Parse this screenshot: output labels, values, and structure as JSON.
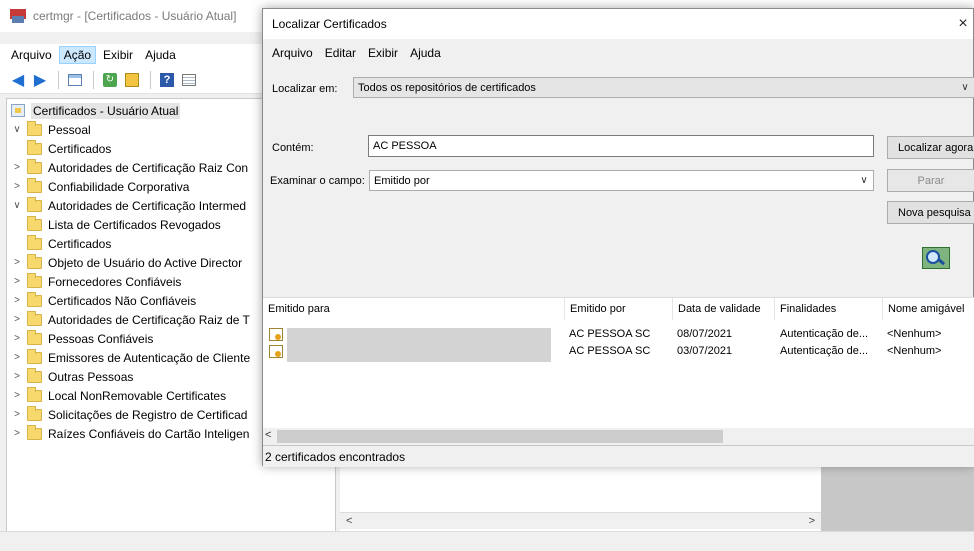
{
  "main_window": {
    "title": "certmgr - [Certificados - Usuário Atual]",
    "menu": [
      "Arquivo",
      "Ação",
      "Exibir",
      "Ajuda"
    ],
    "active_menu": "Ação",
    "toolbar_icons": [
      "back-arrow-icon",
      "forward-arrow-icon",
      "show-hide-tree-icon",
      "refresh-icon",
      "export-list-icon",
      "help-icon",
      "properties-view-icon"
    ],
    "tree": {
      "root": "Certificados - Usuário Atual",
      "items": [
        {
          "label": "Pessoal",
          "level": 1,
          "expanded": true
        },
        {
          "label": "Certificados",
          "level": 2
        },
        {
          "label": "Autoridades de Certificação Raiz Con",
          "level": 1,
          "expanded": false
        },
        {
          "label": "Confiabilidade Corporativa",
          "level": 1,
          "expanded": false
        },
        {
          "label": "Autoridades de Certificação Intermed",
          "level": 1,
          "expanded": true
        },
        {
          "label": "Lista de Certificados Revogados",
          "level": 2
        },
        {
          "label": "Certificados",
          "level": 2
        },
        {
          "label": "Objeto de Usuário do Active Director",
          "level": 1,
          "expanded": false
        },
        {
          "label": "Fornecedores Confiáveis",
          "level": 1,
          "expanded": false
        },
        {
          "label": "Certificados Não Confiáveis",
          "level": 1,
          "expanded": false
        },
        {
          "label": "Autoridades de Certificação Raiz de T",
          "level": 1,
          "expanded": false
        },
        {
          "label": "Pessoas Confiáveis",
          "level": 1,
          "expanded": false
        },
        {
          "label": "Emissores de Autenticação de Cliente",
          "level": 1,
          "expanded": false
        },
        {
          "label": "Outras Pessoas",
          "level": 1,
          "expanded": false
        },
        {
          "label": "Local NonRemovable Certificates",
          "level": 1,
          "expanded": false
        },
        {
          "label": "Solicitações de Registro de Certificad",
          "level": 1,
          "expanded": false
        },
        {
          "label": "Raízes Confiáveis do Cartão Inteligen",
          "level": 1,
          "expanded": false
        }
      ]
    }
  },
  "dialog": {
    "title": "Localizar Certificados",
    "close_glyph": "×",
    "menu": [
      "Arquivo",
      "Editar",
      "Exibir",
      "Ajuda"
    ],
    "localizar_em_label": "Localizar em:",
    "localizar_em_value": "Todos os repositórios de certificados",
    "contem_label": "Contém:",
    "contem_value": "AC PESSOA",
    "examinar_label": "Examinar o campo:",
    "examinar_value": "Emitido por",
    "buttons": {
      "localizar_agora": "Localizar agora",
      "parar": "Parar",
      "nova_pesquisa": "Nova pesquisa"
    },
    "columns": [
      "Emitido para",
      "Emitido por",
      "Data de validade",
      "Finalidades",
      "Nome amigável"
    ],
    "rows": [
      {
        "emitido_por": "AC PESSOA SC",
        "data": "08/07/2021",
        "finalidades": "Autenticação de...",
        "nome": "<Nenhum>"
      },
      {
        "emitido_por": "AC PESSOA SC",
        "data": "03/07/2021",
        "finalidades": "Autenticação de...",
        "nome": "<Nenhum>"
      }
    ],
    "status": "2 certificados encontrados"
  },
  "glyphs": {
    "chev_expanded": "∨",
    "chev_collapsed": ">",
    "caret": "∨",
    "scroll_left": "<",
    "scroll_right": ">"
  }
}
